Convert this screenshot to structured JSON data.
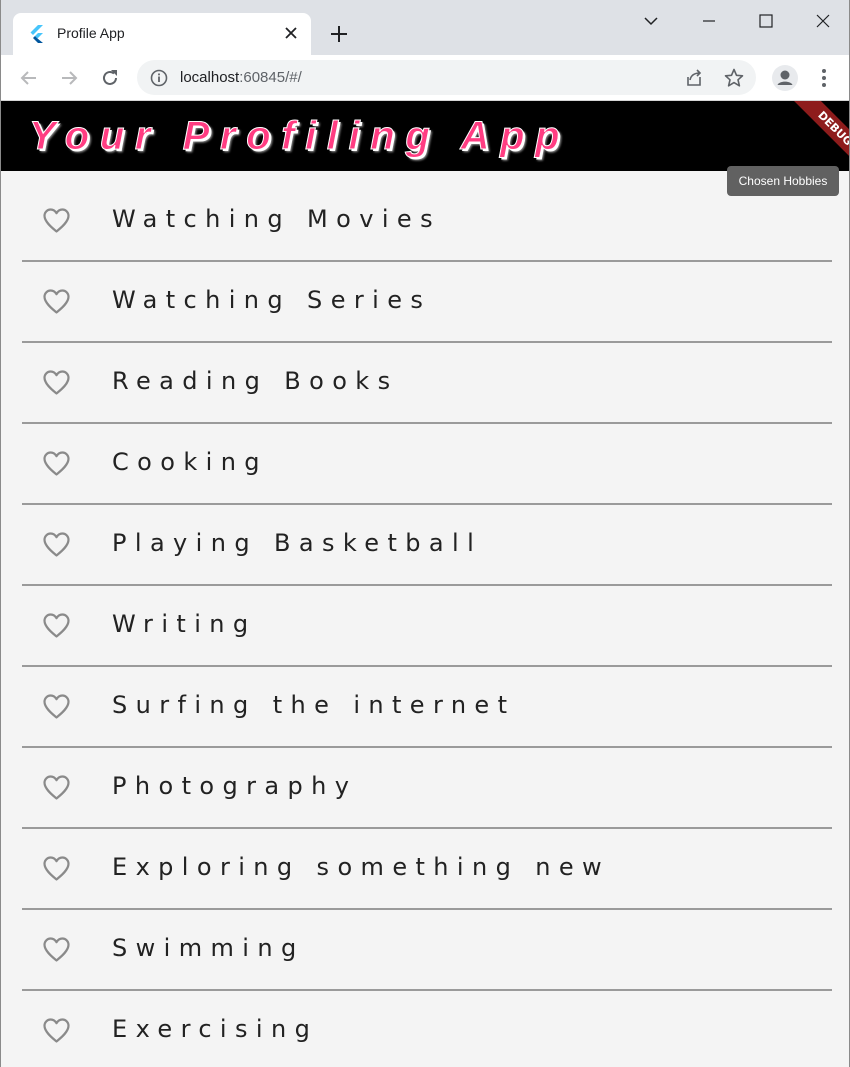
{
  "browser": {
    "tab_title": "Profile App",
    "url_host": "localhost",
    "url_rest": ":60845/#/"
  },
  "appbar": {
    "title": "Your Profiling App",
    "debug_label": "DEBUG",
    "tooltip": "Chosen Hobbies",
    "colors": {
      "title": "#ff3d82",
      "bar": "#000000"
    }
  },
  "hobbies": [
    {
      "label": "Watching Movies",
      "icon": "heart-outline-icon"
    },
    {
      "label": "Watching Series",
      "icon": "heart-outline-icon"
    },
    {
      "label": "Reading Books",
      "icon": "heart-outline-icon"
    },
    {
      "label": "Cooking",
      "icon": "heart-outline-icon"
    },
    {
      "label": "Playing Basketball",
      "icon": "heart-outline-icon"
    },
    {
      "label": "Writing",
      "icon": "heart-outline-icon"
    },
    {
      "label": "Surfing the internet",
      "icon": "heart-outline-icon"
    },
    {
      "label": "Photography",
      "icon": "heart-outline-icon"
    },
    {
      "label": "Exploring something new",
      "icon": "heart-outline-icon"
    },
    {
      "label": "Swimming",
      "icon": "heart-outline-icon"
    },
    {
      "label": "Exercising",
      "icon": "heart-outline-icon"
    }
  ]
}
